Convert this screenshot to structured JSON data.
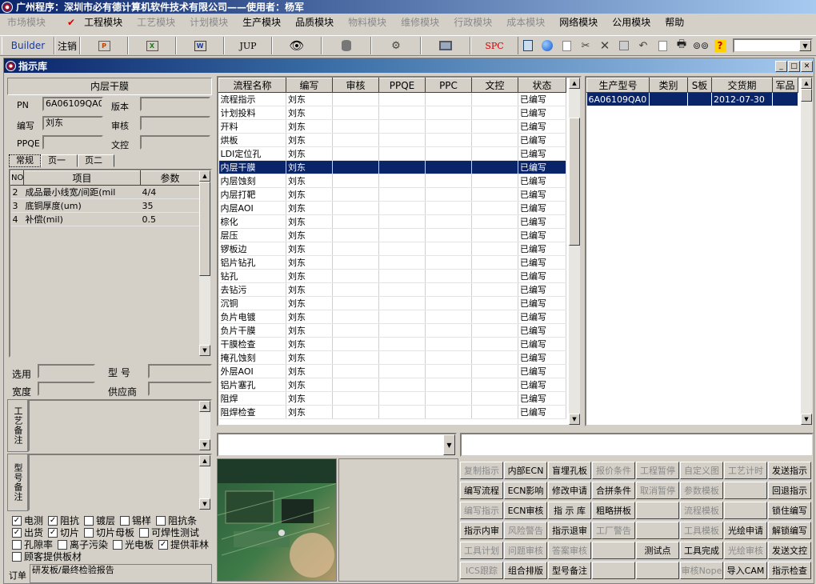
{
  "app": {
    "title": "广州程序：深圳市必有德计算机软件技术有限公司——使用者：杨军"
  },
  "menu": [
    {
      "label": "市场模块",
      "enabled": false
    },
    {
      "label": "工程模块",
      "enabled": true,
      "checked": true
    },
    {
      "label": "工艺模块",
      "enabled": false
    },
    {
      "label": "计划模块",
      "enabled": false
    },
    {
      "label": "生产模块",
      "enabled": true
    },
    {
      "label": "品质模块",
      "enabled": true
    },
    {
      "label": "物料模块",
      "enabled": false
    },
    {
      "label": "维修模块",
      "enabled": false
    },
    {
      "label": "行政模块",
      "enabled": false
    },
    {
      "label": "成本模块",
      "enabled": false
    },
    {
      "label": "网络模块",
      "enabled": true
    },
    {
      "label": "公用模块",
      "enabled": true
    },
    {
      "label": "帮助",
      "enabled": true
    }
  ],
  "toolbar": {
    "builder": "Builder",
    "logout": "注销",
    "jup": "JUP",
    "spc": "SPC"
  },
  "window": {
    "title": "指示库"
  },
  "detail": {
    "heading": "内层干膜",
    "pn_label": "PN",
    "pn_value": "6A06109QA0",
    "version_label": "版本",
    "version_value": "",
    "author_label": "编写",
    "author_value": "刘东",
    "review_label": "审核",
    "review_value": "",
    "ppqe_label": "PPQE",
    "ppqe_value": "",
    "doc_label": "文控",
    "doc_value": "",
    "tabs": [
      "常规",
      "页一",
      "页二"
    ],
    "param_headers": [
      "NO",
      "项目",
      "参数"
    ],
    "params": [
      {
        "no": "2",
        "item": "成品最小线宽/间距(mil",
        "value": "4/4"
      },
      {
        "no": "3",
        "item": "底铜厚度(um)",
        "value": "35"
      },
      {
        "no": "4",
        "item": "补偿(mil)",
        "value": "0.5"
      }
    ],
    "select_label": "选用",
    "model_label": "型  号",
    "width_label": "宽度",
    "supplier_label": "供应商",
    "process_note_label": "工艺备注",
    "model_note_label": "型号备注",
    "checkboxes": [
      [
        {
          "label": "电测",
          "checked": true
        },
        {
          "label": "阻抗",
          "checked": true
        },
        {
          "label": "镀层",
          "checked": false
        },
        {
          "label": "锡样",
          "checked": false
        },
        {
          "label": "阻抗条",
          "checked": false
        }
      ],
      [
        {
          "label": "出货",
          "checked": true
        },
        {
          "label": "切片",
          "checked": true
        },
        {
          "label": "切片母板",
          "checked": false
        },
        {
          "label": "可焊性测试",
          "checked": false
        }
      ],
      [
        {
          "label": "孔隙率",
          "checked": false
        },
        {
          "label": "离子污染",
          "checked": false
        },
        {
          "label": "光电板",
          "checked": false
        },
        {
          "label": "提供菲林",
          "checked": true
        }
      ],
      [
        {
          "label": "顾客提供板材",
          "checked": false
        }
      ]
    ],
    "order_label": "订单",
    "order_note": "研发板/最终检验报告"
  },
  "flow": {
    "headers": [
      "流程名称",
      "编写",
      "审核",
      "PPQE",
      "PPC",
      "文控",
      "状态"
    ],
    "rows": [
      {
        "name": "流程指示",
        "author": "刘东",
        "status": "已编写"
      },
      {
        "name": "计划投料",
        "author": "刘东",
        "status": "已编写"
      },
      {
        "name": "开料",
        "author": "刘东",
        "status": "已编写"
      },
      {
        "name": "烘板",
        "author": "刘东",
        "status": "已编写"
      },
      {
        "name": "LDI定位孔",
        "author": "刘东",
        "status": "已编写"
      },
      {
        "name": "内层干膜",
        "author": "刘东",
        "status": "已编写",
        "selected": true
      },
      {
        "name": "内层蚀刻",
        "author": "刘东",
        "status": "已编写"
      },
      {
        "name": "内层打靶",
        "author": "刘东",
        "status": "已编写"
      },
      {
        "name": "内层AOI",
        "author": "刘东",
        "status": "已编写"
      },
      {
        "name": "棕化",
        "author": "刘东",
        "status": "已编写"
      },
      {
        "name": "层压",
        "author": "刘东",
        "status": "已编写"
      },
      {
        "name": "锣板边",
        "author": "刘东",
        "status": "已编写"
      },
      {
        "name": "铝片钻孔",
        "author": "刘东",
        "status": "已编写"
      },
      {
        "name": "钻孔",
        "author": "刘东",
        "status": "已编写"
      },
      {
        "name": "去钻污",
        "author": "刘东",
        "status": "已编写"
      },
      {
        "name": "沉铜",
        "author": "刘东",
        "status": "已编写"
      },
      {
        "name": "负片电镀",
        "author": "刘东",
        "status": "已编写"
      },
      {
        "name": "负片干膜",
        "author": "刘东",
        "status": "已编写"
      },
      {
        "name": "干膜检查",
        "author": "刘东",
        "status": "已编写"
      },
      {
        "name": "掩孔蚀刻",
        "author": "刘东",
        "status": "已编写"
      },
      {
        "name": "外层AOI",
        "author": "刘东",
        "status": "已编写"
      },
      {
        "name": "铝片塞孔",
        "author": "刘东",
        "status": "已编写"
      },
      {
        "name": "阻焊",
        "author": "刘东",
        "status": "已编写"
      },
      {
        "name": "阻焊检查",
        "author": "刘东",
        "status": "已编写"
      }
    ]
  },
  "products": {
    "headers": [
      "生产型号",
      "类别",
      "S板",
      "交货期",
      "军品"
    ],
    "rows": [
      {
        "model": "6A06109QA0",
        "category": "",
        "s": "",
        "date": "2012-07-30",
        "mil": ""
      }
    ]
  },
  "buttons": [
    [
      {
        "label": "复制指示",
        "enabled": false
      },
      {
        "label": "内部ECN",
        "enabled": true
      },
      {
        "label": "盲埋孔板",
        "enabled": true
      },
      {
        "label": "报价条件",
        "enabled": false
      },
      {
        "label": "工程暂停",
        "enabled": false
      },
      {
        "label": "自定义图",
        "enabled": false
      },
      {
        "label": "工艺计时",
        "enabled": false
      },
      {
        "label": "发送指示",
        "enabled": true
      }
    ],
    [
      {
        "label": "编写流程",
        "enabled": true
      },
      {
        "label": "ECN影响",
        "enabled": true
      },
      {
        "label": "修改申请",
        "enabled": true
      },
      {
        "label": "合拼条件",
        "enabled": true
      },
      {
        "label": "取消暂停",
        "enabled": false
      },
      {
        "label": "参数模板",
        "enabled": false
      },
      {
        "label": "",
        "enabled": true
      },
      {
        "label": "回退指示",
        "enabled": true
      }
    ],
    [
      {
        "label": "编写指示",
        "enabled": false
      },
      {
        "label": "ECN审核",
        "enabled": true
      },
      {
        "label": "指 示 库",
        "enabled": true
      },
      {
        "label": "粗略拼板",
        "enabled": true
      },
      {
        "label": "",
        "enabled": true
      },
      {
        "label": "流程模板",
        "enabled": false
      },
      {
        "label": "",
        "enabled": true
      },
      {
        "label": "锁住编写",
        "enabled": true
      }
    ],
    [
      {
        "label": "指示内审",
        "enabled": true
      },
      {
        "label": "风险警告",
        "enabled": false
      },
      {
        "label": "指示退审",
        "enabled": true
      },
      {
        "label": "工厂警告",
        "enabled": false
      },
      {
        "label": "",
        "enabled": true
      },
      {
        "label": "工具模板",
        "enabled": false
      },
      {
        "label": "光绘申请",
        "enabled": true
      },
      {
        "label": "解锁编写",
        "enabled": true
      }
    ],
    [
      {
        "label": "工具计划",
        "enabled": false
      },
      {
        "label": "问题审核",
        "enabled": false
      },
      {
        "label": "答案审核",
        "enabled": false
      },
      {
        "label": "",
        "enabled": true
      },
      {
        "label": "测试点",
        "enabled": true
      },
      {
        "label": "工具完成",
        "enabled": true
      },
      {
        "label": "光绘审核",
        "enabled": false
      },
      {
        "label": "发送文控",
        "enabled": true
      }
    ],
    [
      {
        "label": "ICS跟踪",
        "enabled": false
      },
      {
        "label": "组合排版",
        "enabled": true
      },
      {
        "label": "型号备注",
        "enabled": true
      },
      {
        "label": "",
        "enabled": true
      },
      {
        "label": "",
        "enabled": true
      },
      {
        "label": "审核Nope",
        "enabled": false
      },
      {
        "label": "导入CAM",
        "enabled": true
      },
      {
        "label": "指示检查",
        "enabled": true
      }
    ]
  ]
}
